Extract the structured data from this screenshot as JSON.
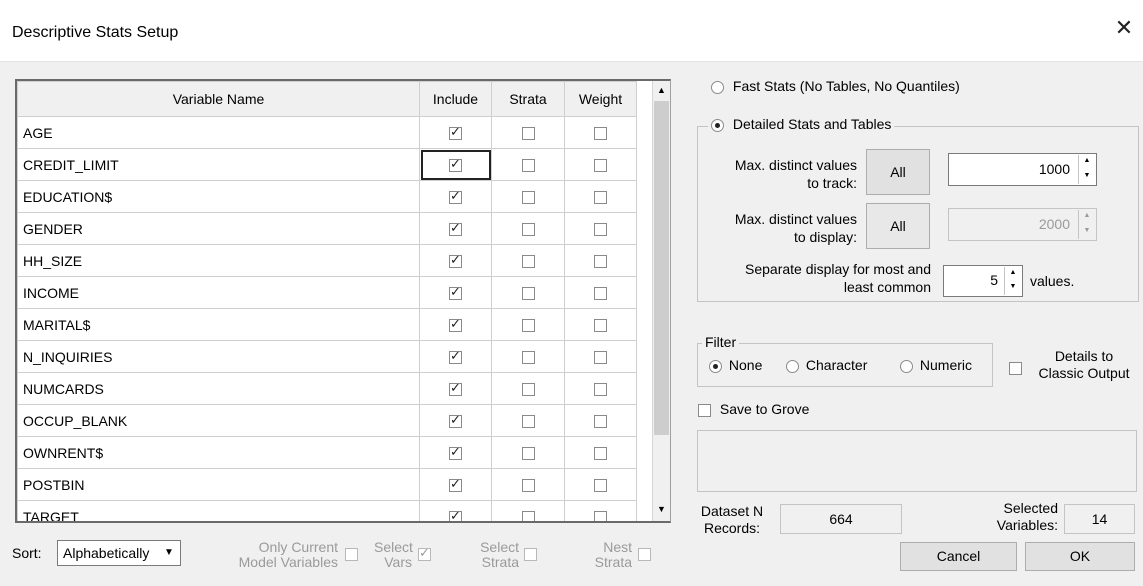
{
  "window": {
    "title": "Descriptive Stats Setup"
  },
  "grid": {
    "headers": [
      "Variable Name",
      "Include",
      "Strata",
      "Weight"
    ],
    "rows": [
      {
        "name": "AGE",
        "include": true
      },
      {
        "name": "CREDIT_LIMIT",
        "include": true
      },
      {
        "name": "EDUCATION$",
        "include": true
      },
      {
        "name": "GENDER",
        "include": true
      },
      {
        "name": "HH_SIZE",
        "include": true
      },
      {
        "name": "INCOME",
        "include": true
      },
      {
        "name": "MARITAL$",
        "include": true
      },
      {
        "name": "N_INQUIRIES",
        "include": true
      },
      {
        "name": "NUMCARDS",
        "include": true
      },
      {
        "name": "OCCUP_BLANK",
        "include": true
      },
      {
        "name": "OWNRENT$",
        "include": true
      },
      {
        "name": "POSTBIN",
        "include": true
      },
      {
        "name": "TARGET",
        "include": true
      }
    ]
  },
  "bottom": {
    "sort_label": "Sort:",
    "sort_value": "Alphabetically",
    "only_current_line1": "Only Current",
    "only_current_line2": "Model Variables",
    "select_vars_line1": "Select",
    "select_vars_line2": "Vars",
    "select_strata_line1": "Select",
    "select_strata_line2": "Strata",
    "nest_strata_line1": "Nest",
    "nest_strata_line2": "Strata"
  },
  "stats": {
    "fast_label": "Fast Stats (No Tables, No Quantiles)",
    "detailed_label": "Detailed Stats and Tables",
    "track_label_1": "Max. distinct values",
    "track_label_2": "to track:",
    "track_button": "All",
    "track_value": "1000",
    "display_label_1": "Max. distinct values",
    "display_label_2": "to display:",
    "display_button": "All",
    "display_value": "2000",
    "separate_label_1": "Separate display for most and",
    "separate_label_2": "least common",
    "separate_value": "5",
    "values_label": "values."
  },
  "filter": {
    "legend": "Filter",
    "none": "None",
    "character": "Character",
    "numeric": "Numeric"
  },
  "details": {
    "line1": "Details to",
    "line2": "Classic Output"
  },
  "save_to_grove": "Save to Grove",
  "info": {
    "dataset_label_1": "Dataset N",
    "dataset_label_2": "Records:",
    "dataset_value": "664",
    "selected_label_1": "Selected",
    "selected_label_2": "Variables:",
    "selected_value": "14"
  },
  "buttons": {
    "cancel": "Cancel",
    "ok": "OK"
  }
}
